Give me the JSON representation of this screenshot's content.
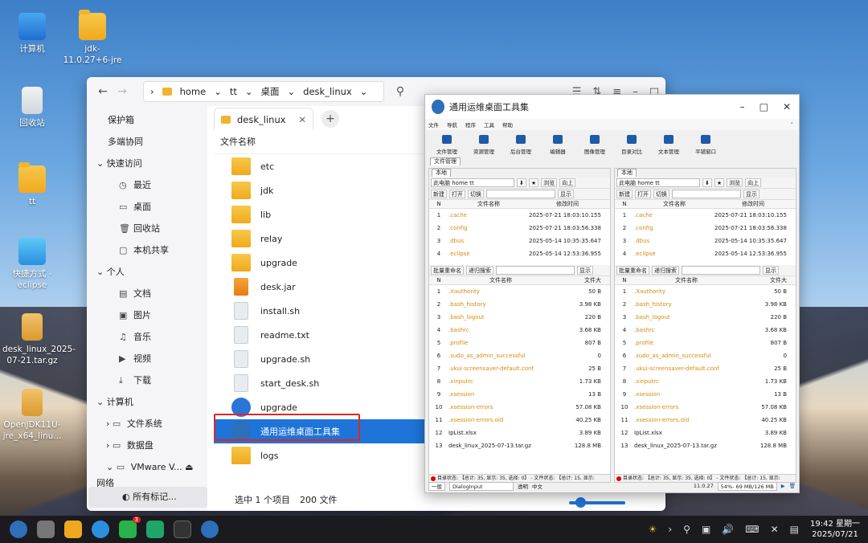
{
  "desktop": {
    "icons": [
      "计算机",
      "jdk-11.0.27+6-jre",
      "回收站",
      "tt",
      "快捷方式 - eclipse",
      "desk_linux_2025-07-21.tar.gz",
      "OpenJDK11U-jre_x64_linu..."
    ]
  },
  "file_manager": {
    "breadcrumb": [
      "home",
      "tt",
      "桌面",
      "desk_linux"
    ],
    "sidebar": {
      "group1": "保护箱",
      "group2": "多端协同",
      "quick": "快速访问",
      "quick_items": [
        "最近",
        "桌面",
        "回收站",
        "本机共享"
      ],
      "personal": "个人",
      "personal_items": [
        "文档",
        "图片",
        "音乐",
        "视频",
        "下载"
      ],
      "computer": "计算机",
      "computer_items": [
        "文件系统",
        "数据盘",
        "VMware V..."
      ],
      "network": "网络",
      "tags": "所有标记..."
    },
    "tab": "desk_linux",
    "column_header": "文件名称",
    "files": [
      "etc",
      "jdk",
      "lib",
      "relay",
      "upgrade",
      "desk.jar",
      "install.sh",
      "readme.txt",
      "upgrade.sh",
      "start_desk.sh",
      "upgrade",
      "通用运维桌面工具集",
      "logs"
    ],
    "status": {
      "selected": "选中 1 个项目",
      "count": "200 文件"
    }
  },
  "tool": {
    "title": "通用运维桌面工具集",
    "menu": [
      "文件",
      "导航",
      "程序",
      "工具",
      "帮助"
    ],
    "toolbar": [
      "文件管理",
      "资源管理",
      "后台管理",
      "编辑器",
      "图像管理",
      "目录对比",
      "文本管理",
      "平铺窗口"
    ],
    "subtab": "文件管理",
    "pane_tab": "本地",
    "path": "此电脑 home tt",
    "btns": {
      "browse": "浏览",
      "up": "向上",
      "new": "新建",
      "open": "打开",
      "cut": "切换",
      "show": "显示",
      "rename": "批量重命名",
      "search": "递归搜索"
    },
    "head_top": {
      "n": "N",
      "name": "文件名称",
      "time": "修改时间"
    },
    "top_rows": [
      {
        "n": "1",
        "name": ".cache",
        "time": "2025-07-21 18:03:10.155"
      },
      {
        "n": "2",
        "name": ".config",
        "time": "2025-07-21 18:03:56.338"
      },
      {
        "n": "3",
        "name": ".dbus",
        "time": "2025-05-14 10:35:35.647"
      },
      {
        "n": "4",
        "name": ".eclipse",
        "time": "2025-05-14 12:53:36.955"
      }
    ],
    "head_bottom": {
      "n": "N",
      "name": "文件名称",
      "size": "文件大"
    },
    "bottom_rows": [
      {
        "n": "1",
        "name": ".Xauthority",
        "size": "50 B"
      },
      {
        "n": "2",
        "name": ".bash_history",
        "size": "3.98 KB"
      },
      {
        "n": "3",
        "name": ".bash_logout",
        "size": "220 B"
      },
      {
        "n": "4",
        "name": ".bashrc",
        "size": "3.68 KB"
      },
      {
        "n": "5",
        "name": ".profile",
        "size": "807 B"
      },
      {
        "n": "6",
        "name": ".sudo_as_admin_successful",
        "size": "0"
      },
      {
        "n": "7",
        "name": ".ukui-screensaver-default.conf",
        "size": "25 B"
      },
      {
        "n": "8",
        "name": ".xinputrc",
        "size": "1.73 KB"
      },
      {
        "n": "9",
        "name": ".xsession",
        "size": "13 B"
      },
      {
        "n": "10",
        "name": ".xsession-errors",
        "size": "57.08 KB"
      },
      {
        "n": "11",
        "name": ".xsession-errors.old",
        "size": "40.25 KB"
      },
      {
        "n": "12",
        "name": "IpList.xlsx",
        "size": "3.89 KB"
      },
      {
        "n": "13",
        "name": "desk_linux_2025-07-13.tar.gz",
        "size": "128.8 MB"
      }
    ],
    "status_left": "目录状态: 【总计: 35, 显示: 35, 选择: 0】 - 文件状态: 【总计: 15, 显示:",
    "bottom": {
      "level": "一般",
      "input": "DialogInput",
      "mode": "透明",
      "lang": "中文",
      "ver": "11.0.27",
      "mem": "54%- 69 MB/126 MB"
    }
  },
  "taskbar": {
    "time": "19:42 星期一",
    "date": "2025/07/21",
    "badge": "3"
  }
}
